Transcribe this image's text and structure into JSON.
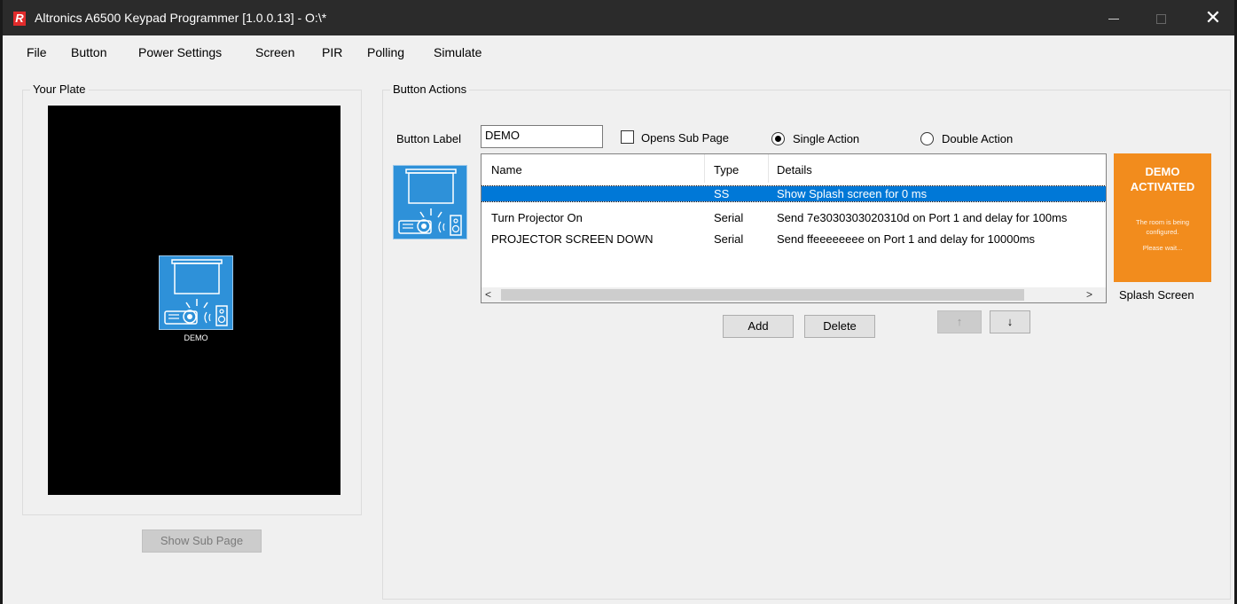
{
  "window": {
    "title": "Altronics A6500 Keypad Programmer [1.0.0.13]  - O:\\*",
    "logo_letter": "R",
    "close_glyph": "✕"
  },
  "menu": [
    "File",
    "Button",
    "Power Settings",
    "Screen",
    "PIR",
    "Polling",
    "Simulate"
  ],
  "plate": {
    "group_title": "Your Plate",
    "button_label": "DEMO",
    "show_sub_page": "Show Sub Page",
    "icon": "projector-screen-icon"
  },
  "actions": {
    "group_title": "Button Actions",
    "button_label_text": "Button Label",
    "button_label_value": "DEMO",
    "opens_sub_page": "Opens Sub Page",
    "opens_sub_page_checked": false,
    "single_action": "Single Action",
    "double_action": "Double Action",
    "selected_mode": "single",
    "columns": [
      "Name",
      "Type",
      "Details"
    ],
    "rows": [
      {
        "name": "",
        "type": "SS",
        "details": "Show Splash screen for 0 ms",
        "selected": true
      },
      {
        "name": "Turn Projector On",
        "type": "Serial",
        "details": "Send 7e3030303020310d on Port 1 and delay for 100ms",
        "selected": false
      },
      {
        "name": "PROJECTOR SCREEN DOWN",
        "type": "Serial",
        "details": "Send ffeeeeeeee on Port 1 and delay for 10000ms",
        "selected": false
      }
    ],
    "add": "Add",
    "delete": "Delete",
    "up": "↑",
    "down": "↓",
    "scroll_left": "<",
    "scroll_right": ">"
  },
  "splash": {
    "title": "DEMO\nACTIVATED",
    "line1": "The room is being\nconfigured.",
    "line2": "Please wait...",
    "caption": "Splash Screen"
  },
  "colors": {
    "titlebar": "#2b2b2b",
    "selection": "#0078d7",
    "button_tile": "#2e91d9",
    "splash": "#f28c1d",
    "logo": "#e12b2b"
  }
}
